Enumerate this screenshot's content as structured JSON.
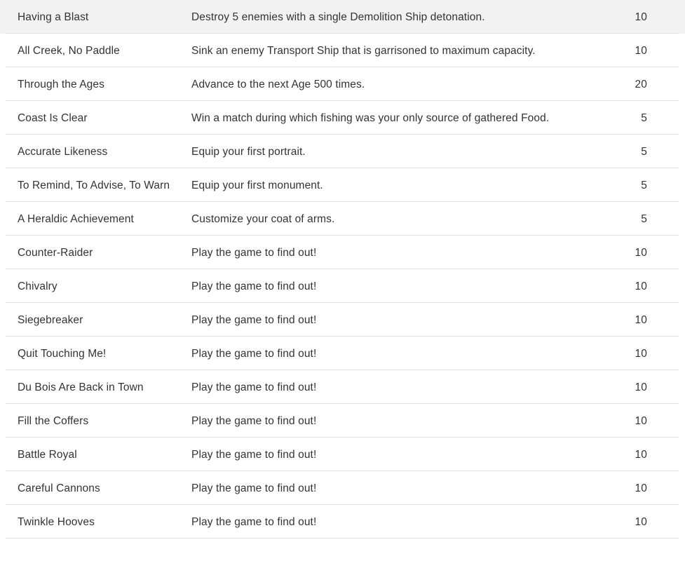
{
  "panel": {
    "name": "achievements-list",
    "colors": {
      "background": "#ffffff",
      "row_highlight": "#f2f2f2",
      "divider": "#e2e2e2",
      "text": "#333333"
    }
  },
  "rows": [
    {
      "title": "Having a Blast",
      "description": "Destroy 5 enemies with a single Demolition Ship detonation.",
      "points": "10",
      "highlighted": true
    },
    {
      "title": "All Creek, No Paddle",
      "description": "Sink an enemy Transport Ship that is garrisoned to maximum capacity.",
      "points": "10",
      "highlighted": false
    },
    {
      "title": "Through the Ages",
      "description": "Advance to the next Age 500 times.",
      "points": "20",
      "highlighted": false
    },
    {
      "title": "Coast Is Clear",
      "description": "Win a match during which fishing was your only source of gathered Food.",
      "points": "5",
      "highlighted": false
    },
    {
      "title": "Accurate Likeness",
      "description": "Equip your first portrait.",
      "points": "5",
      "highlighted": false
    },
    {
      "title": "To Remind, To Advise, To Warn",
      "description": "Equip your first monument.",
      "points": "5",
      "highlighted": false
    },
    {
      "title": "A Heraldic Achievement",
      "description": "Customize your coat of arms.",
      "points": "5",
      "highlighted": false
    },
    {
      "title": "Counter-Raider",
      "description": "Play the game to find out!",
      "points": "10",
      "highlighted": false
    },
    {
      "title": "Chivalry",
      "description": "Play the game to find out!",
      "points": "10",
      "highlighted": false
    },
    {
      "title": "Siegebreaker",
      "description": "Play the game to find out!",
      "points": "10",
      "highlighted": false
    },
    {
      "title": "Quit Touching Me!",
      "description": "Play the game to find out!",
      "points": "10",
      "highlighted": false
    },
    {
      "title": "Du Bois Are Back in Town",
      "description": "Play the game to find out!",
      "points": "10",
      "highlighted": false
    },
    {
      "title": "Fill the Coffers",
      "description": "Play the game to find out!",
      "points": "10",
      "highlighted": false
    },
    {
      "title": "Battle Royal",
      "description": "Play the game to find out!",
      "points": "10",
      "highlighted": false
    },
    {
      "title": "Careful Cannons",
      "description": "Play the game to find out!",
      "points": "10",
      "highlighted": false
    },
    {
      "title": "Twinkle Hooves",
      "description": "Play the game to find out!",
      "points": "10",
      "highlighted": false
    }
  ]
}
